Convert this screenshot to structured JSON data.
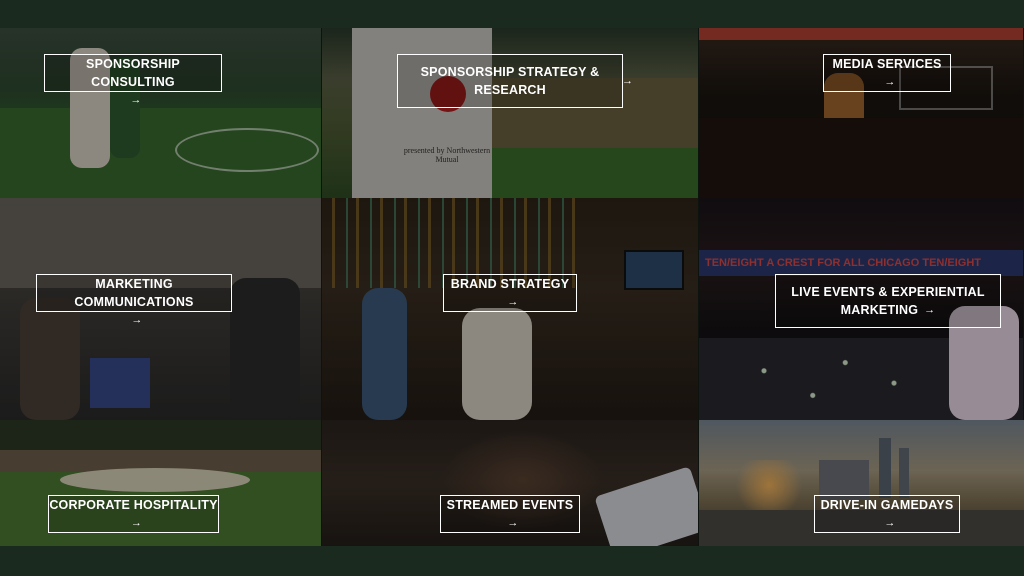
{
  "tiles": [
    {
      "label": "SPONSORSHIP CONSULTING"
    },
    {
      "label": "SPONSORSHIP STRATEGY & RESEARCH"
    },
    {
      "label": "MEDIA SERVICES"
    },
    {
      "label": "MARKETING COMMUNICATIONS"
    },
    {
      "label": "BRAND STRATEGY"
    },
    {
      "label_line1": "LIVE EVENTS & EXPERIENTIAL",
      "label_line2": "MARKETING"
    },
    {
      "label": "CORPORATE HOSPITALITY"
    },
    {
      "label": "STREAMED EVENTS"
    },
    {
      "label": "DRIVE-IN GAMEDAYS"
    }
  ],
  "arrow_icon": "→",
  "banner_text": "TEN/EIGHT  A CREST FOR ALL CHICAGO  TEN/EIGHT",
  "flag_text": "presented by Northwestern Mutual"
}
